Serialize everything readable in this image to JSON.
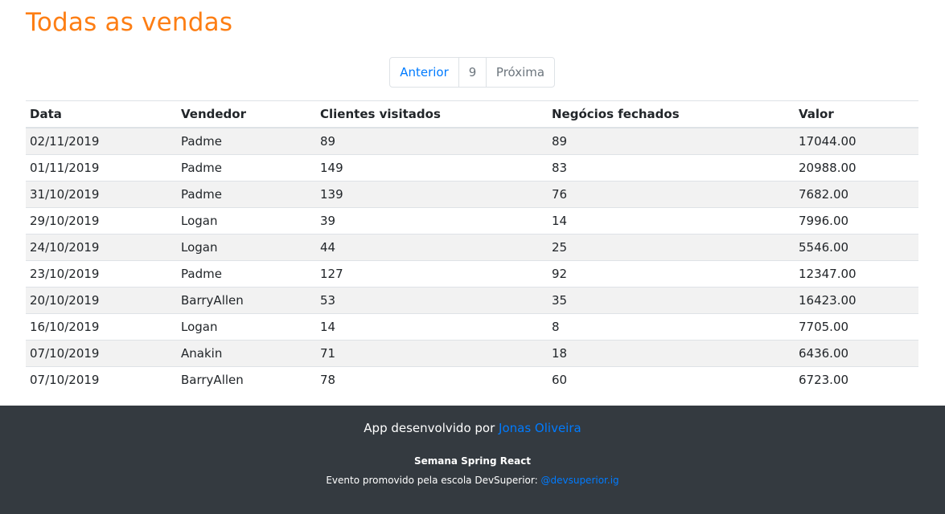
{
  "page": {
    "title": "Todas as vendas"
  },
  "pagination": {
    "prev_label": "Anterior",
    "current_page": "9",
    "next_label": "Próxima"
  },
  "table": {
    "columns": [
      "Data",
      "Vendedor",
      "Clientes visitados",
      "Negócios fechados",
      "Valor"
    ],
    "rows": [
      [
        "02/11/2019",
        "Padme",
        "89",
        "89",
        "17044.00"
      ],
      [
        "01/11/2019",
        "Padme",
        "149",
        "83",
        "20988.00"
      ],
      [
        "31/10/2019",
        "Padme",
        "139",
        "76",
        "7682.00"
      ],
      [
        "29/10/2019",
        "Logan",
        "39",
        "14",
        "7996.00"
      ],
      [
        "24/10/2019",
        "Logan",
        "44",
        "25",
        "5546.00"
      ],
      [
        "23/10/2019",
        "Padme",
        "127",
        "92",
        "12347.00"
      ],
      [
        "20/10/2019",
        "BarryAllen",
        "53",
        "35",
        "16423.00"
      ],
      [
        "16/10/2019",
        "Logan",
        "14",
        "8",
        "7705.00"
      ],
      [
        "07/10/2019",
        "Anakin",
        "71",
        "18",
        "6436.00"
      ],
      [
        "07/10/2019",
        "BarryAllen",
        "78",
        "60",
        "6723.00"
      ]
    ]
  },
  "footer": {
    "credit_prefix": "App desenvolvido por",
    "credit_link": "Jonas Oliveira",
    "event_name": "Semana Spring React",
    "event_text": "Evento promovido pela escola DevSuperior:",
    "event_link": "@devsuperior.ig"
  },
  "colors": {
    "title": "#fd7e14",
    "link": "#007bff",
    "footer_bg": "#343a40",
    "stripe": "#f2f2f2"
  }
}
